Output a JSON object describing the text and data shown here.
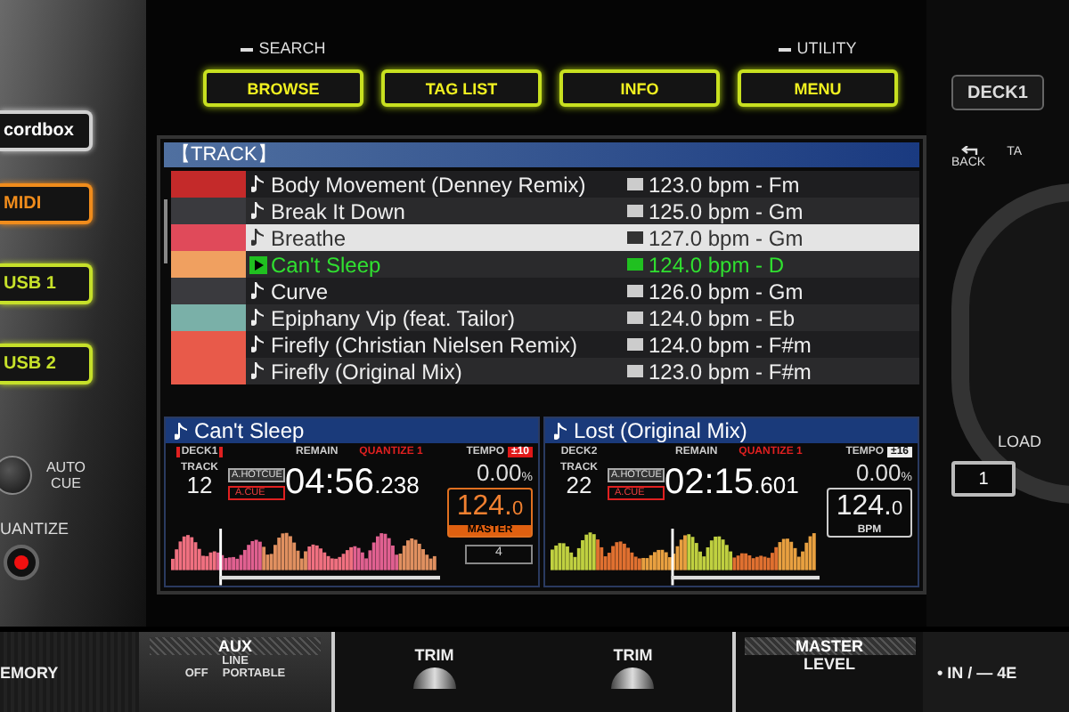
{
  "nav_buttons": [
    {
      "label": "BROWSE",
      "caption": "SEARCH"
    },
    {
      "label": "TAG LIST"
    },
    {
      "label": "INFO"
    },
    {
      "label": "MENU",
      "caption": "UTILITY"
    }
  ],
  "left_panel": {
    "source_buttons": [
      {
        "label": "cordbox",
        "color": "#d0d0d0"
      },
      {
        "label": "MIDI",
        "color": "#f08c1c"
      },
      {
        "label": "USB 1",
        "color": "#c6e02a"
      },
      {
        "label": "USB 2",
        "color": "#c6e02a"
      }
    ],
    "auto_cue_label": "AUTO CUE",
    "quantize_label": "UANTIZE",
    "quantize_on": true
  },
  "right_panel": {
    "deck_button": "DECK1",
    "back_label": "BACK",
    "tag_label": "TA",
    "load_label": "LOAD",
    "load_button": "1"
  },
  "screen": {
    "header": "【TRACK】",
    "tracks": [
      {
        "title": "Body Movement (Denney Remix)",
        "info": "123.0 bpm - Fm",
        "selected": false,
        "playing": false,
        "color": "#c42a2a"
      },
      {
        "title": "Break It Down",
        "info": "125.0 bpm - Gm",
        "selected": false,
        "playing": false,
        "color": "#3a3a3e"
      },
      {
        "title": "Breathe",
        "info": "127.0 bpm - Gm",
        "selected": true,
        "playing": false,
        "color": "#e04a5a"
      },
      {
        "title": "Can't Sleep",
        "info": "124.0 bpm - D",
        "selected": false,
        "playing": true,
        "color": "#f0a060"
      },
      {
        "title": "Curve",
        "info": "126.0 bpm - Gm",
        "selected": false,
        "playing": false,
        "color": "#3a3a3e"
      },
      {
        "title": "Epiphany Vip (feat. Tailor)",
        "info": "124.0 bpm - Eb",
        "selected": false,
        "playing": false,
        "color": "#7ab0a8"
      },
      {
        "title": "Firefly (Christian Nielsen Remix)",
        "info": "124.0 bpm - F#m",
        "selected": false,
        "playing": false,
        "color": "#e85a4a"
      },
      {
        "title": "Firefly (Original Mix)",
        "info": "123.0 bpm - F#m",
        "selected": false,
        "playing": false,
        "color": "#e85a4a"
      }
    ],
    "decks": [
      {
        "title": "Can't Sleep",
        "deck": "DECK1",
        "track_label": "TRACK",
        "track": "12",
        "hotcue": "A.HOTCUE",
        "cue": "A.CUE",
        "remain_label": "REMAIN",
        "quantize": "QUANTIZE 1",
        "time": "04:56",
        "time_ms": ".238",
        "tempo_label": "TEMPO",
        "tempo_range": "±10",
        "tempo": "0.00",
        "tempo_unit": "%",
        "bpm": "124.",
        "bpm_decimal": "0",
        "master": true,
        "bpm_caption": "MASTER",
        "extra": "4"
      },
      {
        "title": "Lost (Original Mix)",
        "deck": "DECK2",
        "track_label": "TRACK",
        "track": "22",
        "hotcue": "A.HOTCUE",
        "cue": "A.CUE",
        "remain_label": "REMAIN",
        "quantize": "QUANTIZE 1",
        "time": "02:15",
        "time_ms": ".601",
        "tempo_label": "TEMPO",
        "tempo_range": "±16",
        "tempo": "0.00",
        "tempo_unit": "%",
        "bpm": "124.",
        "bpm_decimal": "0",
        "master": false,
        "bpm_caption": "BPM"
      }
    ]
  },
  "mixer": {
    "memory_label": "EMORY",
    "aux": {
      "title": "AUX",
      "line": "LINE",
      "off": "OFF",
      "portable": "PORTABLE"
    },
    "trims": [
      "TRIM",
      "TRIM"
    ],
    "master": {
      "title": "MASTER",
      "level": "LEVEL"
    },
    "input_label": "• IN / — 4E"
  }
}
